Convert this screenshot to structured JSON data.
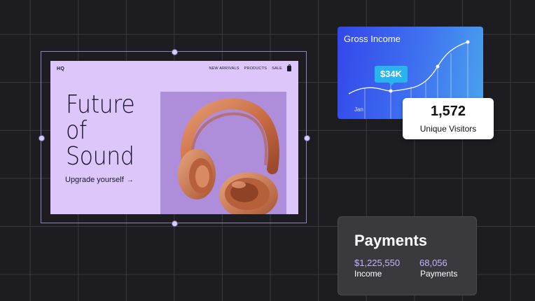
{
  "website": {
    "logo": "HQ",
    "nav": [
      "NEW ARRIVALS",
      "PRODUCTS",
      "SALE"
    ],
    "cart_icon": "shopping-bag-icon",
    "hero_lines": [
      "Future",
      "of",
      "Sound"
    ],
    "cta_label": "Upgrade yourself",
    "cta_icon": "arrow-right-icon",
    "image": "headphones-product-image"
  },
  "gross_income": {
    "title": "Gross Income",
    "tooltip_value": "$34K",
    "month_label": "Jan"
  },
  "visitors": {
    "value": "1,572",
    "label": "Unique Visitors"
  },
  "payments": {
    "title": "Payments",
    "income_value": "$1,225,550",
    "income_label": "Income",
    "count_value": "68,056",
    "count_label": "Payments"
  },
  "colors": {
    "background": "#1d1c20",
    "site_background": "#dcc6fa",
    "hero_image_background": "#ae8ddb",
    "income_gradient_start": "#3347ea",
    "income_gradient_end": "#4aa3ee",
    "tooltip": "#2ab4ee",
    "payment_value": "#c7b3ff"
  }
}
